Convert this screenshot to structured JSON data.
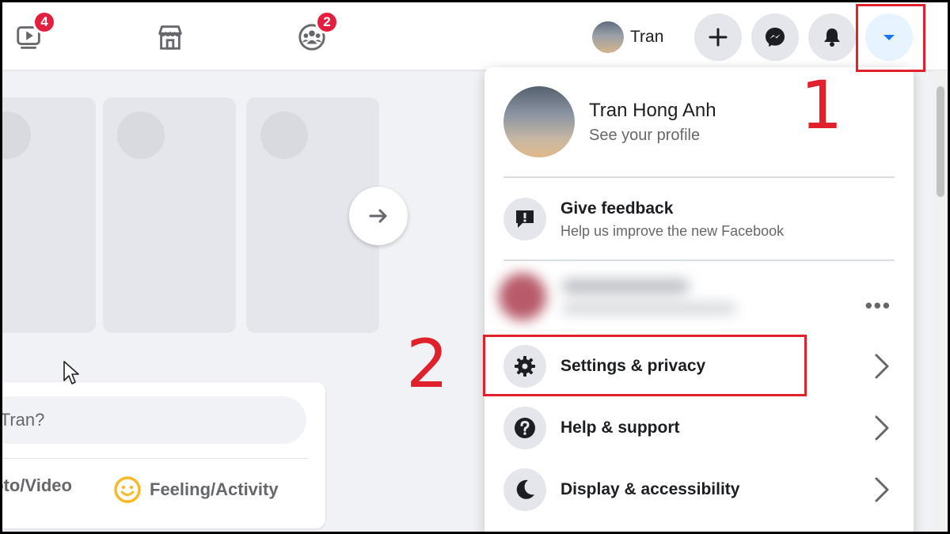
{
  "topbar": {
    "watch_badge": "4",
    "groups_badge": "2",
    "profile_name": "Tran"
  },
  "feed": {
    "composer_placeholder": "l, Tran?",
    "photo_video_label": "Photo/Video",
    "feeling_label": "Feeling/Activity"
  },
  "dropdown": {
    "profile_name": "Tran Hong Anh",
    "profile_sub": "See your profile",
    "feedback_title": "Give feedback",
    "feedback_desc": "Help us improve the new Facebook",
    "items": [
      {
        "label": "Settings & privacy",
        "icon": "gear-icon"
      },
      {
        "label": "Help & support",
        "icon": "question-icon"
      },
      {
        "label": "Display & accessibility",
        "icon": "moon-icon"
      }
    ]
  },
  "annotations": {
    "step1": "1",
    "step2": "2"
  },
  "colors": {
    "accent": "#1877f2",
    "highlight": "#e0202a",
    "badge": "#e41e3f"
  }
}
